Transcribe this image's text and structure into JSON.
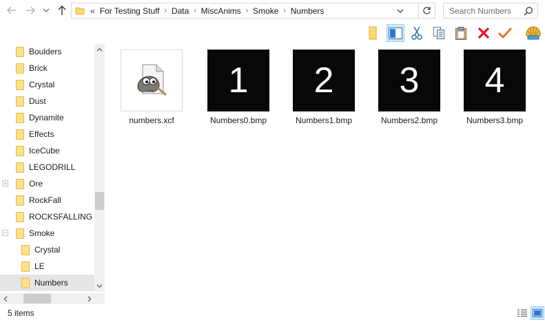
{
  "address": {
    "overflow_glyph": "«",
    "crumbs": [
      "For Testing Stuff",
      "Data",
      "MiscAnims",
      "Smoke",
      "Numbers"
    ],
    "folder_icon": "folder-icon"
  },
  "search": {
    "placeholder": "Search Numbers"
  },
  "toolbar": {
    "icons": [
      "folder-icon",
      "preview-pane-icon",
      "cut-icon",
      "copy-icon",
      "paste-icon",
      "delete-icon",
      "checkmark-icon",
      "shell-icon"
    ],
    "accent": "#0078d7",
    "delete_color": "#e81123",
    "check_color": "#e8761a"
  },
  "nav": {
    "items": [
      {
        "label": "Boulders",
        "indent": 0
      },
      {
        "label": "Brick",
        "indent": 0
      },
      {
        "label": "Crystal",
        "indent": 0
      },
      {
        "label": "Dust",
        "indent": 0
      },
      {
        "label": "Dynamite",
        "indent": 0
      },
      {
        "label": "Effects",
        "indent": 0
      },
      {
        "label": "IceCube",
        "indent": 0
      },
      {
        "label": "LEGODRILL",
        "indent": 0
      },
      {
        "label": "Ore",
        "indent": 0,
        "expandable": true
      },
      {
        "label": "RockFall",
        "indent": 0
      },
      {
        "label": "ROCKSFALLING",
        "indent": 0
      },
      {
        "label": "Smoke",
        "indent": 0,
        "expanded": true
      },
      {
        "label": "Crystal",
        "indent": 1
      },
      {
        "label": "LE",
        "indent": 1
      },
      {
        "label": "Numbers",
        "indent": 1,
        "selected": true
      }
    ]
  },
  "files": [
    {
      "name": "numbers.xcf",
      "thumb": "gimp-icon"
    },
    {
      "name": "Numbers0.bmp",
      "digit": "1"
    },
    {
      "name": "Numbers1.bmp",
      "digit": "2"
    },
    {
      "name": "Numbers2.bmp",
      "digit": "3"
    },
    {
      "name": "Numbers3.bmp",
      "digit": "4"
    }
  ],
  "status": {
    "count": "5 items"
  }
}
